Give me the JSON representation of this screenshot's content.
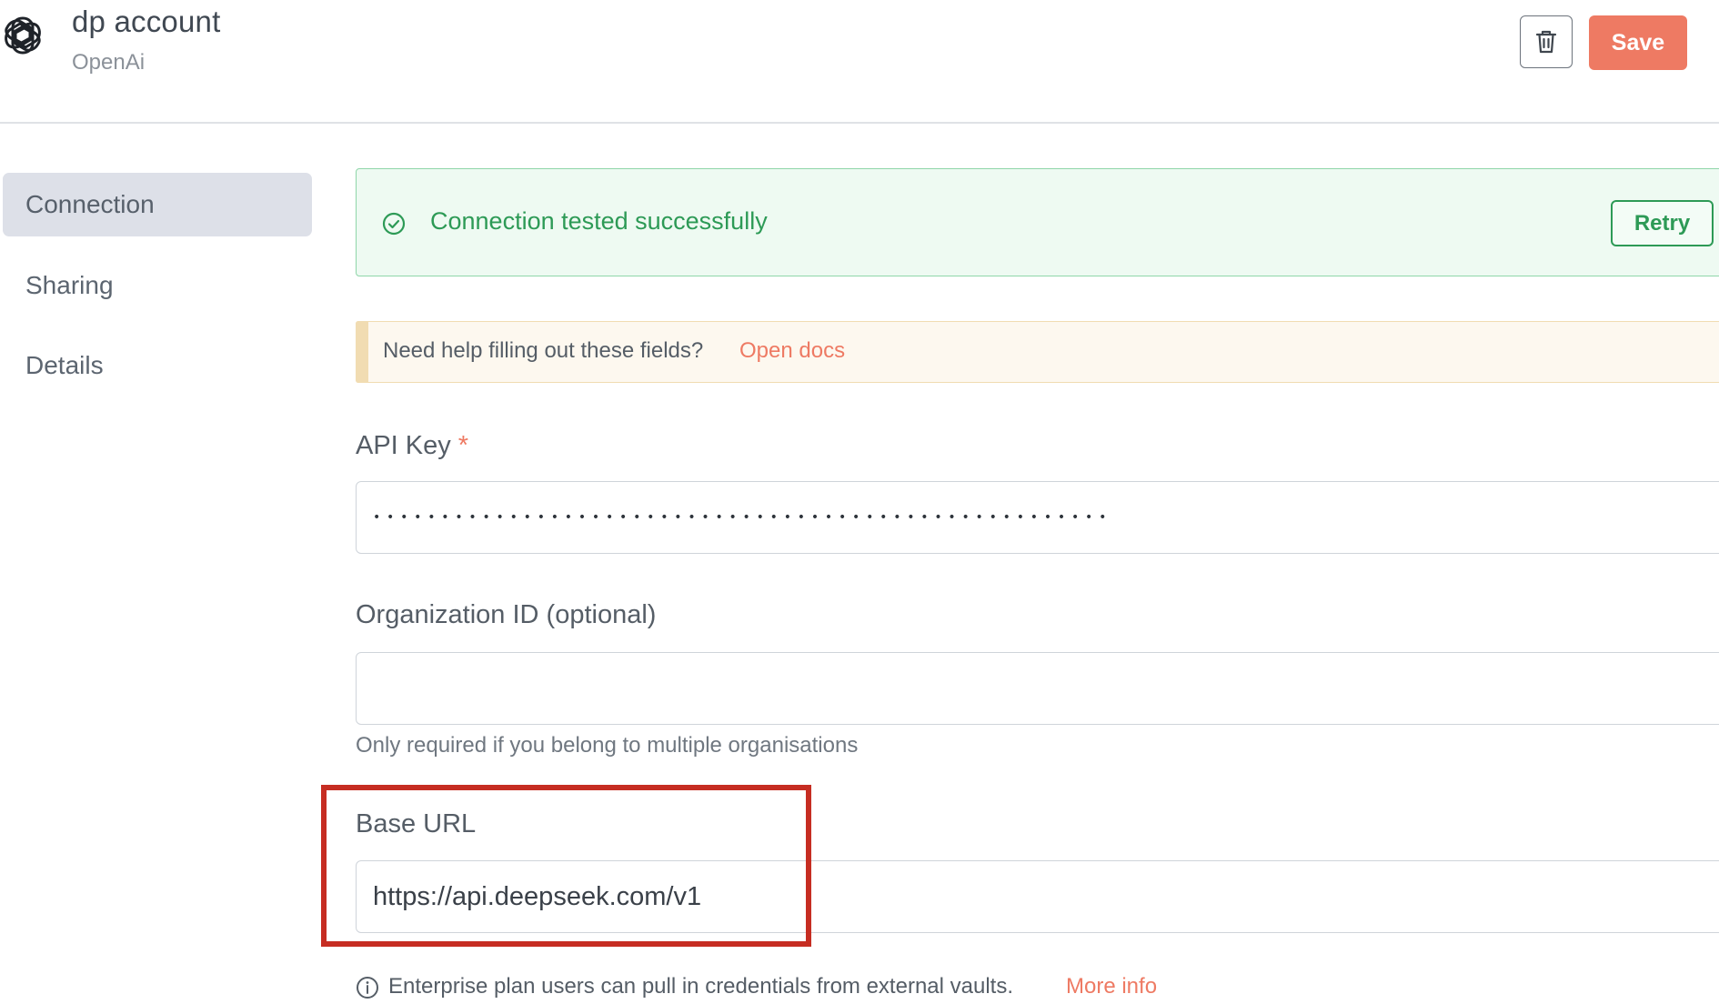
{
  "header": {
    "logo_icon": "openai-logo-icon",
    "title": "dp account",
    "subtitle": "OpenAi",
    "delete_icon": "trash-icon",
    "save_label": "Save"
  },
  "sidebar": {
    "items": [
      {
        "label": "Connection",
        "active": true
      },
      {
        "label": "Sharing",
        "active": false
      },
      {
        "label": "Details",
        "active": false
      }
    ]
  },
  "status_banner": {
    "icon": "check-circle-icon",
    "message": "Connection tested successfully",
    "retry_label": "Retry"
  },
  "help_banner": {
    "text": "Need help filling out these fields?",
    "link_label": "Open docs"
  },
  "fields": {
    "api_key": {
      "label": "API Key",
      "required_marker": "*",
      "masked_value": "••••••••••••••••••••••••••••••••••••••••••••••••••••••"
    },
    "organization_id": {
      "label": "Organization ID (optional)",
      "value": "",
      "hint": "Only required if you belong to multiple organisations"
    },
    "base_url": {
      "label": "Base URL",
      "value": "https://api.deepseek.com/v1"
    }
  },
  "enterprise_note": {
    "icon": "info-circle-icon",
    "text": "Enterprise plan users can pull in credentials from external vaults.",
    "link_label": "More info"
  },
  "colors": {
    "accent": "#ee7a63",
    "success": "#2d9a56",
    "highlight": "#c62d22"
  }
}
